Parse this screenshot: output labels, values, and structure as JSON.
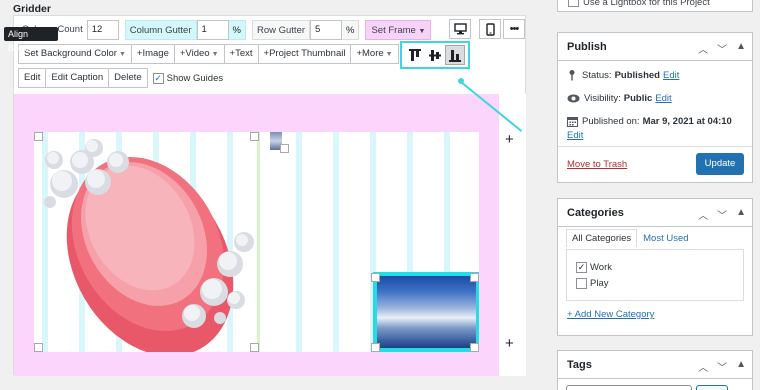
{
  "gridder": {
    "title": "Gridder",
    "tooltip": "Align Bottom",
    "column_count_label": "Column Count",
    "column_count": "12",
    "column_gutter_label": "Column Gutter",
    "column_gutter": "1",
    "row_gutter_label": "Row Gutter",
    "row_gutter": "5",
    "percent": "%",
    "set_frame": "Set Frame",
    "toolbar": {
      "set_background_color": "Set Background Color",
      "image": "Image",
      "video": "Video",
      "text": "Text",
      "project_thumbnail": "Project Thumbnail",
      "more": "More"
    },
    "actions": {
      "edit": "Edit",
      "edit_caption": "Edit Caption",
      "delete": "Delete",
      "show_guides": "Show Guides"
    },
    "icons": [
      "desktop-icon",
      "mobile-icon",
      "more-dots-icon",
      "align-top-icon",
      "align-middle-icon",
      "align-bottom-icon",
      "plus-icon"
    ],
    "colors": {
      "frame": "#fcd5fc",
      "guides": "#d9f7fb",
      "highlight": "#3ed6e2",
      "soap": "#f2717f"
    }
  },
  "sidebar": {
    "lightbox_label": "Use a Lightbox for this Project",
    "publish": {
      "title": "Publish",
      "status_label": "Status:",
      "status_value": "Published",
      "visibility_label": "Visibility:",
      "visibility_value": "Public",
      "published_on_label": "Published on:",
      "published_on_value": "Mar 9, 2021 at 04:10",
      "edit": "Edit",
      "move_to_trash": "Move to Trash",
      "update": "Update"
    },
    "categories": {
      "title": "Categories",
      "tab_all": "All Categories",
      "tab_most_used": "Most Used",
      "items": [
        {
          "label": "Work",
          "checked": true
        },
        {
          "label": "Play",
          "checked": false
        }
      ],
      "add_new": "+ Add New Category"
    },
    "tags": {
      "title": "Tags"
    }
  }
}
